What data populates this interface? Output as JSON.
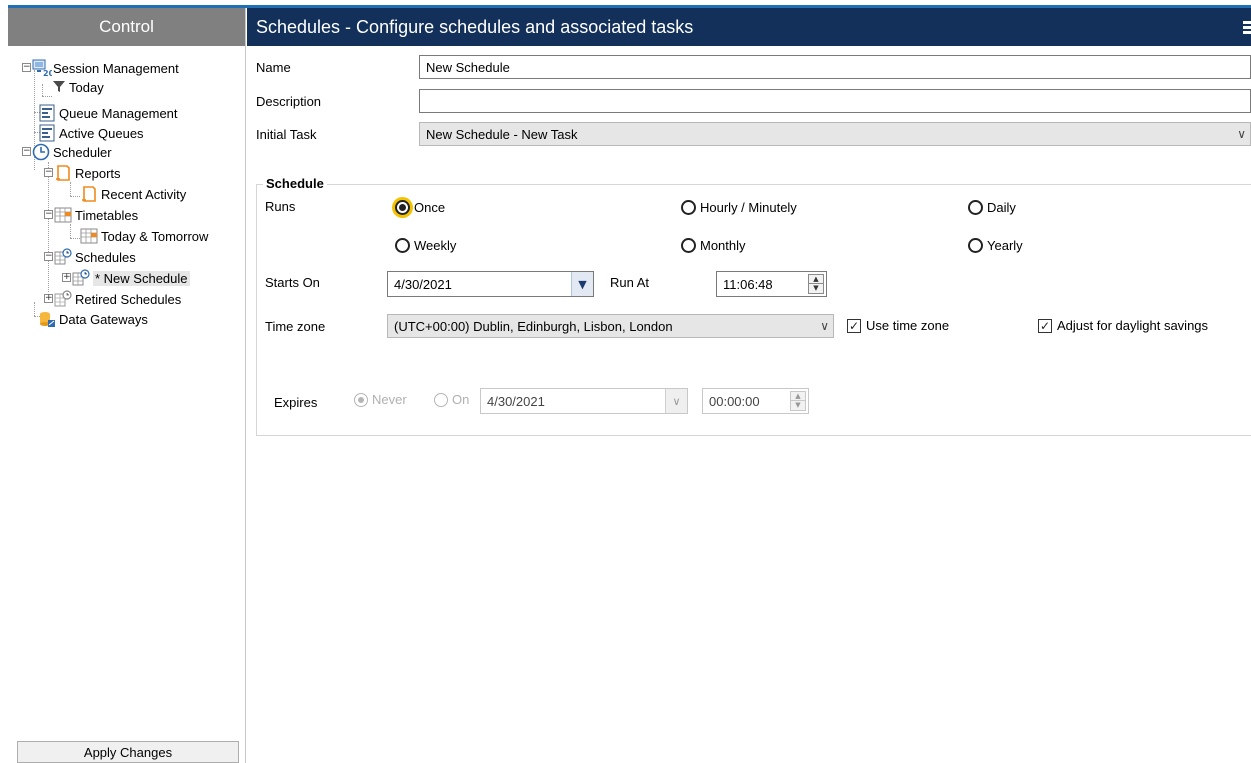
{
  "left_panel": {
    "title": "Control",
    "tree": {
      "session_management": "Session Management",
      "today": "Today",
      "queue_management": "Queue Management",
      "active_queues": "Active Queues",
      "scheduler": "Scheduler",
      "reports": "Reports",
      "recent_activity": "Recent Activity",
      "timetables": "Timetables",
      "today_tomorrow": "Today & Tomorrow",
      "schedules": "Schedules",
      "new_schedule": "* New Schedule",
      "retired_schedules": "Retired Schedules",
      "data_gateways": "Data Gateways"
    },
    "apply_label": "Apply Changes"
  },
  "header": {
    "title": "Schedules - Configure schedules and associated tasks"
  },
  "form": {
    "name_label": "Name",
    "name_value": "New Schedule",
    "description_label": "Description",
    "description_value": "",
    "initial_task_label": "Initial Task",
    "initial_task_value": "New Schedule - New Task"
  },
  "schedule": {
    "group_title": "Schedule",
    "runs_label": "Runs",
    "options": {
      "once": "Once",
      "hourly": "Hourly / Minutely",
      "daily": "Daily",
      "weekly": "Weekly",
      "monthly": "Monthly",
      "yearly": "Yearly"
    },
    "selected": "Once",
    "starts_on_label": "Starts On",
    "starts_on_value": "4/30/2021",
    "run_at_label": "Run At",
    "run_at_value": "11:06:48",
    "time_zone_label": "Time zone",
    "time_zone_value": "(UTC+00:00) Dublin, Edinburgh, Lisbon, London",
    "use_time_zone_label": "Use time zone",
    "use_time_zone_checked": true,
    "daylight_label": "Adjust for daylight savings",
    "daylight_checked": true,
    "expires_label": "Expires",
    "never_label": "Never",
    "on_label": "On",
    "expires_date_value": "4/30/2021",
    "expires_time_value": "00:00:00"
  },
  "colors": {
    "header_bg": "#12305a",
    "left_header_bg": "#808080",
    "accent_blue": "#1f6fb5",
    "focus_ring": "#f3c300"
  }
}
